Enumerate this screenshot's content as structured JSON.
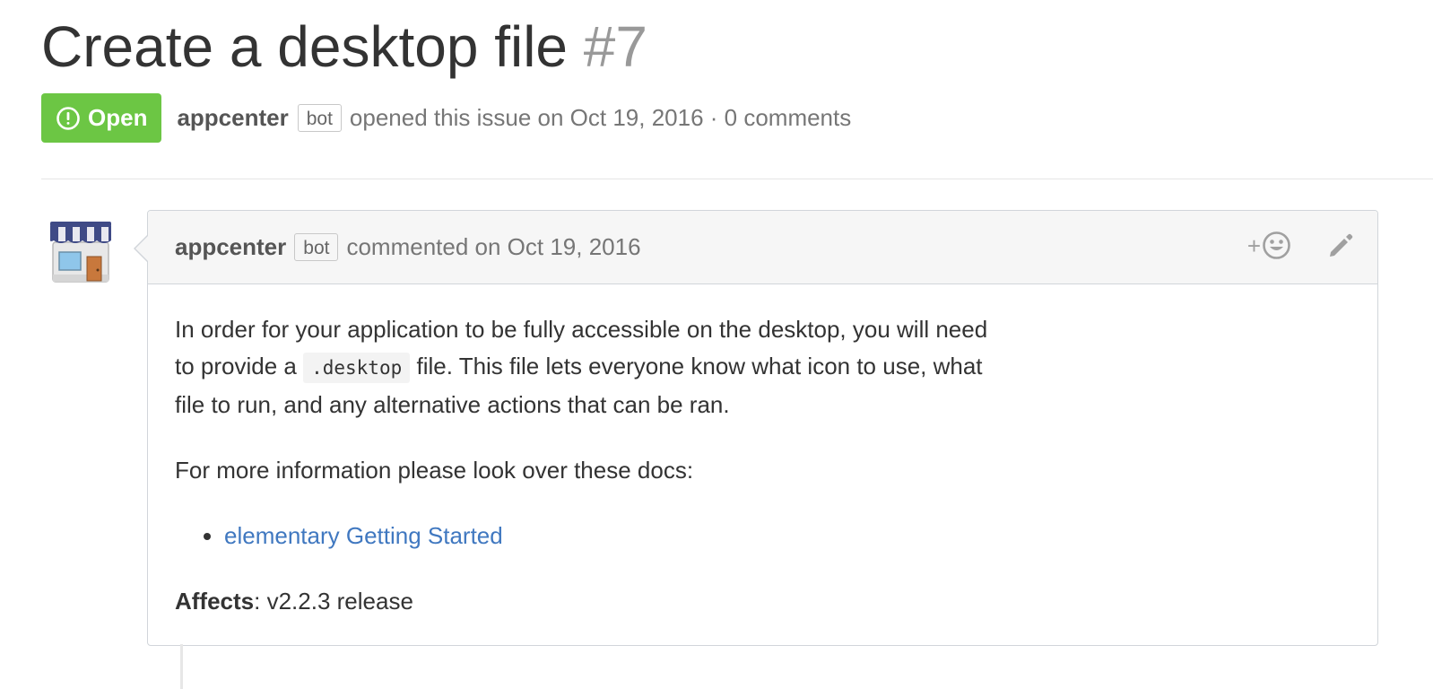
{
  "issue": {
    "title": "Create a desktop file",
    "number": "#7",
    "state_label": "Open",
    "author": "appcenter",
    "author_badge": "bot",
    "opened_text": "opened this issue on Oct 19, 2016 · 0 comments"
  },
  "comment": {
    "author": "appcenter",
    "author_badge": "bot",
    "date_text": "commented on Oct 19, 2016",
    "reaction_plus": "+",
    "body": {
      "para1_before": "In order for your application to be fully accessible on the desktop, you will need to provide a ",
      "para1_code": ".desktop",
      "para1_after": " file. This file lets everyone know what icon to use, what file to run, and any alternative actions that can be ran.",
      "para2": "For more information please look over these docs:",
      "links": [
        "elementary Getting Started"
      ],
      "affects_label": "Affects",
      "affects_value": ": v2.2.3 release"
    }
  },
  "icons": {
    "state": "issue-opened-icon",
    "reaction": "smiley-icon",
    "edit": "pencil-icon",
    "avatar": "appcenter-store-avatar"
  },
  "colors": {
    "open_badge": "#6cc644",
    "link": "#4078c0",
    "header_bg": "#f6f6f6",
    "border": "#d1d5da"
  }
}
